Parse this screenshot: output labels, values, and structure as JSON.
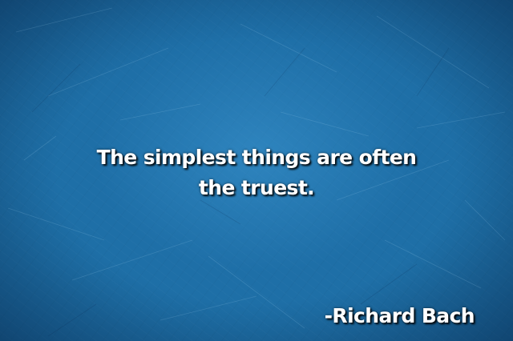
{
  "quote": {
    "line1": "The simplest things are often",
    "line2": "the truest."
  },
  "author": "-Richard Bach",
  "colors": {
    "background": "#1e6fa6",
    "text": "#ffffff"
  }
}
